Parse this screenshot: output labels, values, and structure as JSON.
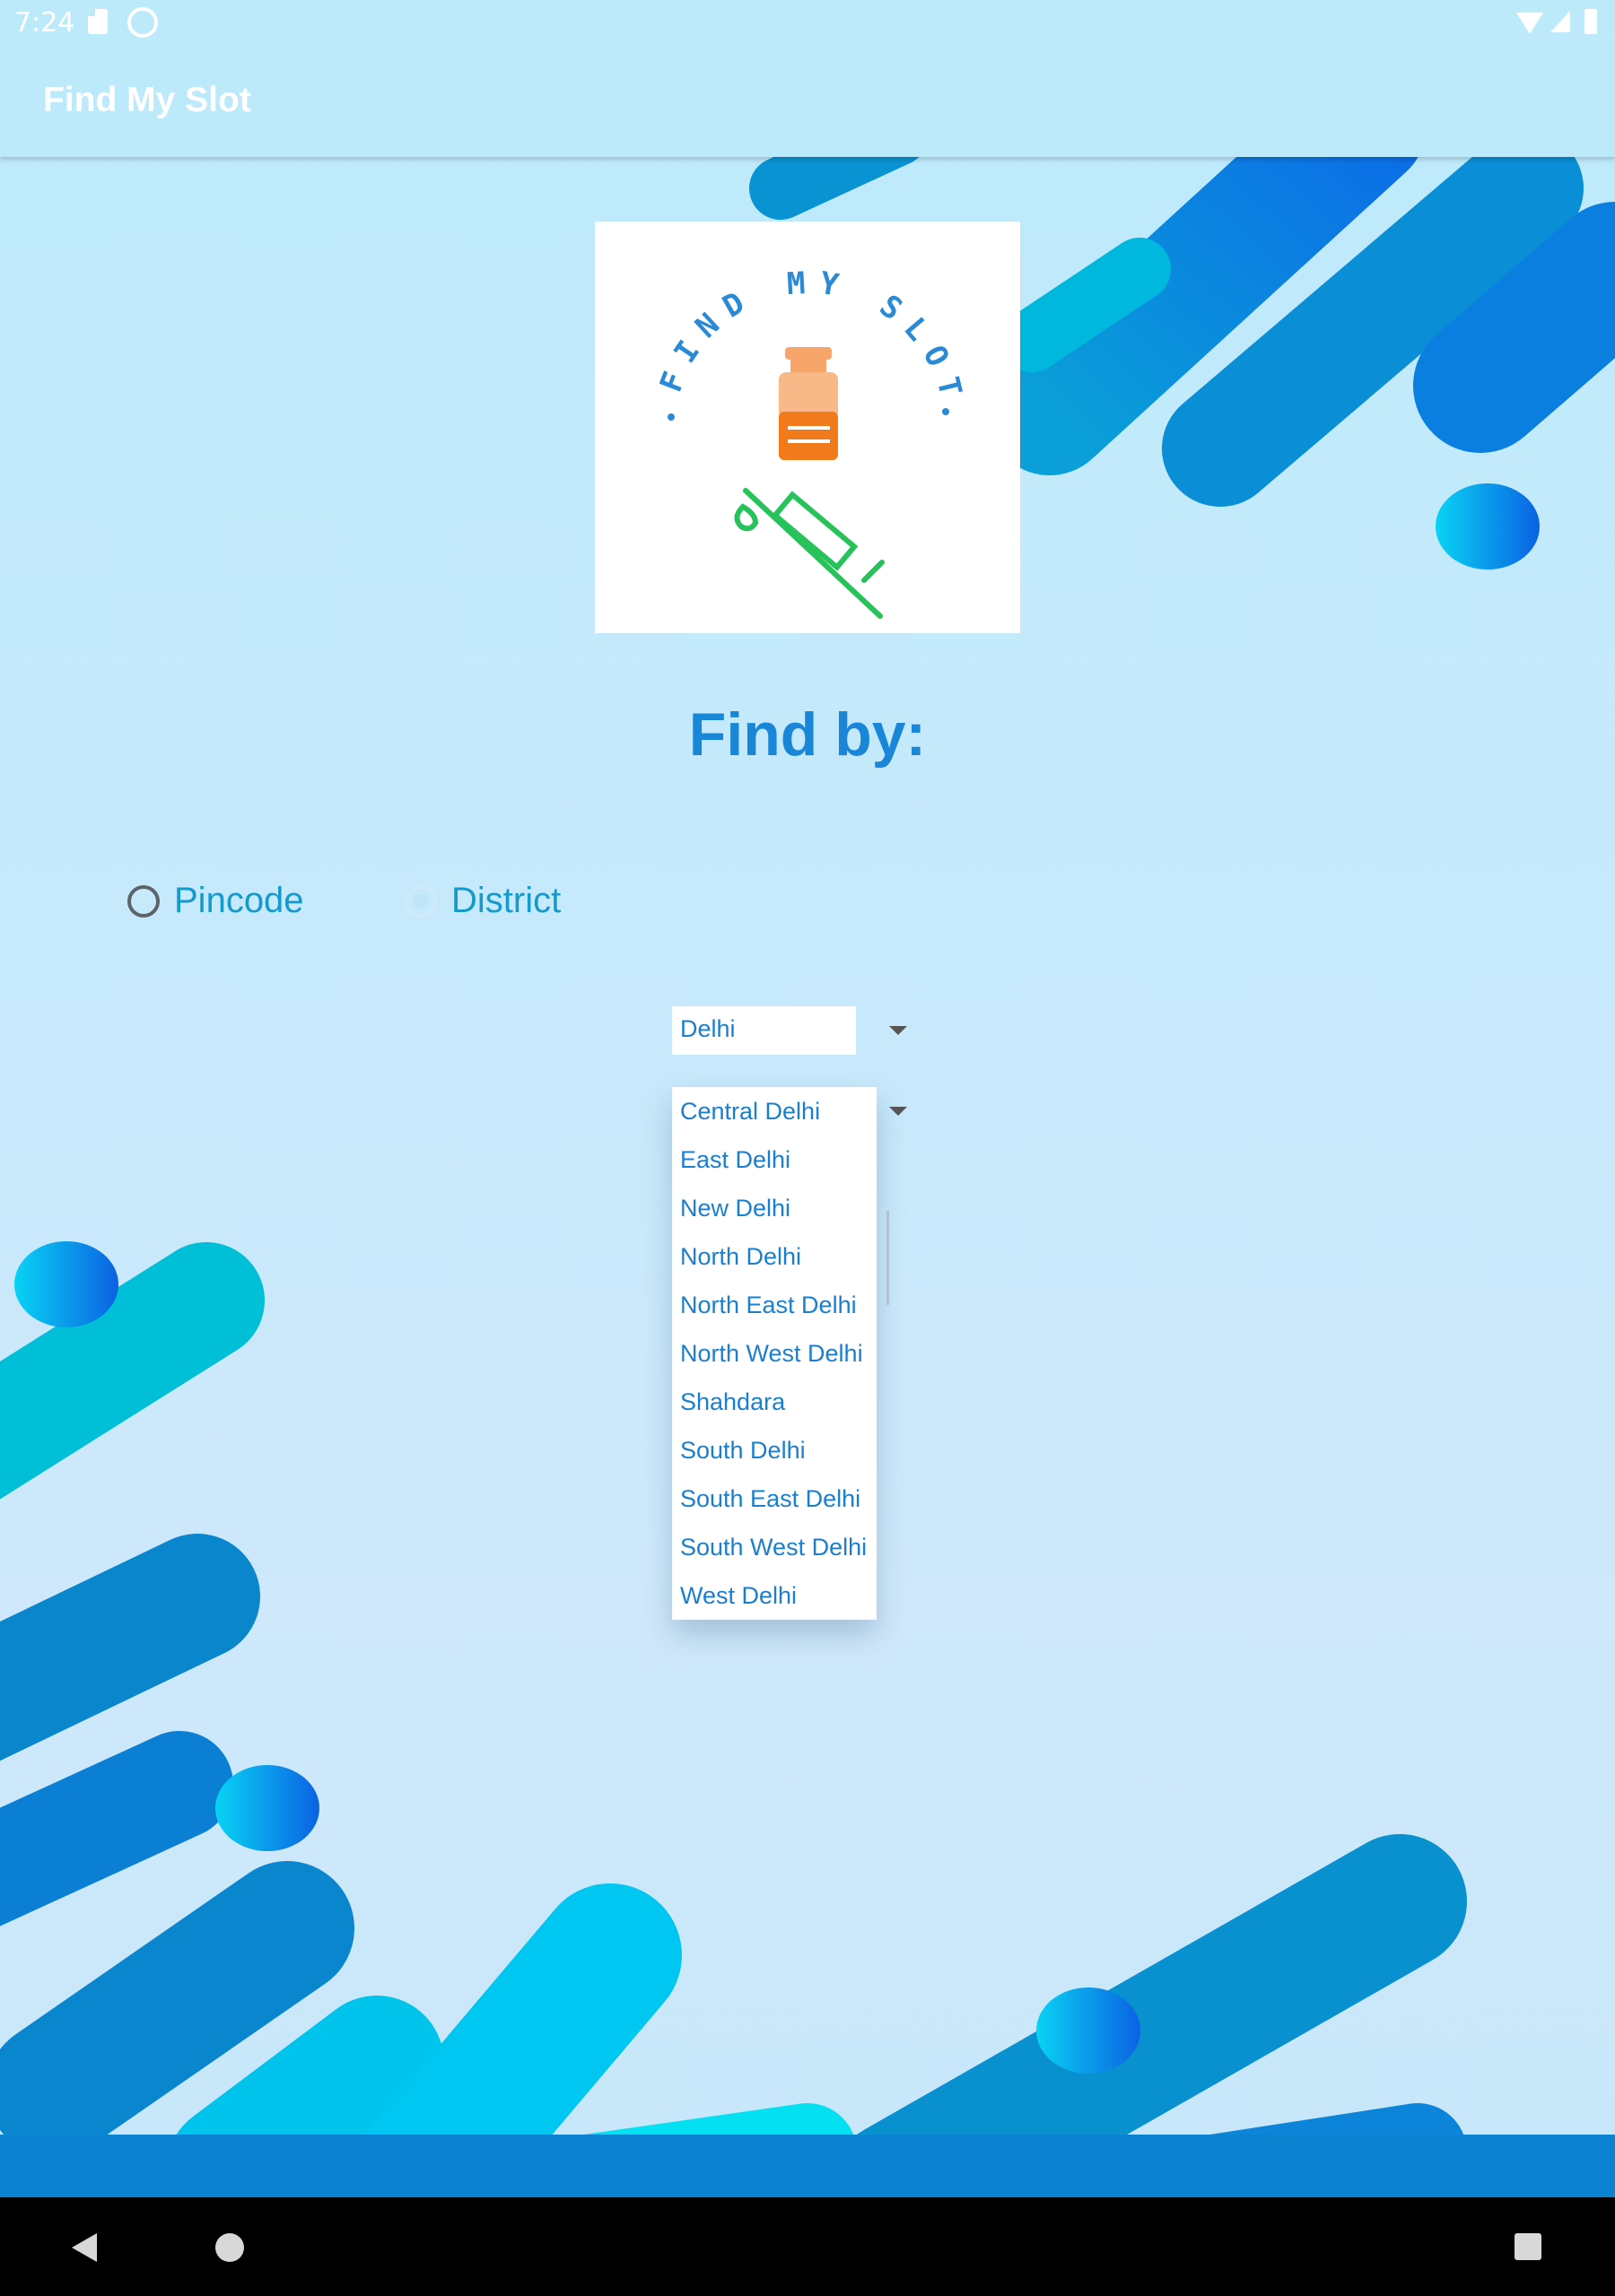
{
  "status_bar": {
    "time": "7:24",
    "icons": [
      "sd-card-icon",
      "sync-icon",
      "wifi-icon",
      "signal-icon",
      "battery-icon"
    ]
  },
  "app_bar": {
    "title": "Find My Slot"
  },
  "logo": {
    "text": "FIND MY SLOT",
    "icons": [
      "vaccine-vial-icon",
      "syringe-icon"
    ]
  },
  "find_by": {
    "heading": "Find by:"
  },
  "radio_group": {
    "options": [
      {
        "label": "Pincode",
        "checked": false
      },
      {
        "label": "District",
        "checked": true
      }
    ]
  },
  "state_select": {
    "value": "Delhi"
  },
  "district_dropdown": {
    "options": [
      "Central Delhi",
      "East Delhi",
      "New Delhi",
      "North Delhi",
      "North East Delhi",
      "North West Delhi",
      "Shahdara",
      "South Delhi",
      "South East Delhi",
      "South West Delhi",
      "West Delhi"
    ]
  },
  "colors": {
    "accent": "#1a86d8",
    "option_text": "#1b7fcf",
    "app_bar": "#bdeafb",
    "radio_label": "#159acb"
  },
  "nav_bar": {
    "icons": [
      "back-icon",
      "home-icon",
      "recents-icon"
    ]
  }
}
